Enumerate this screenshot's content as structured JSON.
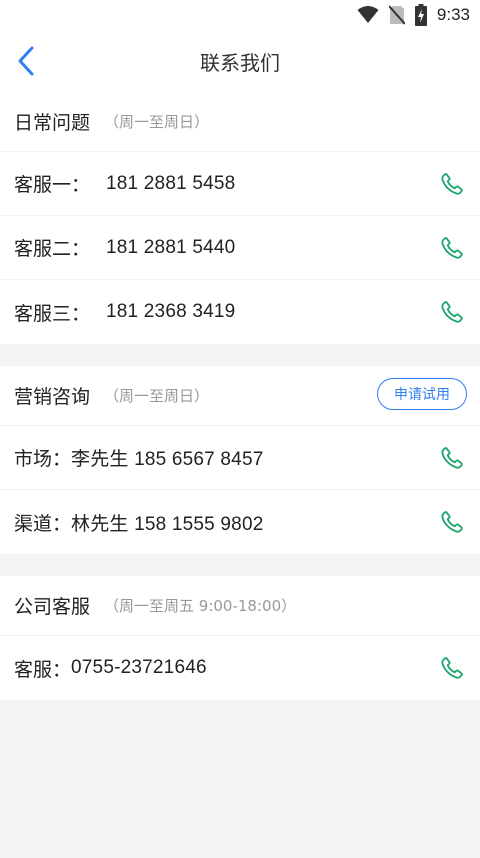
{
  "status_bar": {
    "time": "9:33"
  },
  "header": {
    "title": "联系我们"
  },
  "sections": [
    {
      "title": "日常问题",
      "note": "（周一至周日）",
      "rows": [
        {
          "label": "客服一：",
          "value": "181 2881 5458"
        },
        {
          "label": "客服二：",
          "value": "181 2881 5440"
        },
        {
          "label": "客服三：",
          "value": "181 2368 3419"
        }
      ]
    },
    {
      "title": "营销咨询",
      "note": "（周一至周日）",
      "button": "申请试用",
      "rows": [
        {
          "label": "市场：",
          "value": "李先生 185 6567 8457"
        },
        {
          "label": "渠道：",
          "value": "林先生 158 1555 9802"
        }
      ]
    },
    {
      "title": "公司客服",
      "note": "（周一至周五 9:00-18:00）",
      "rows": [
        {
          "label": "客服：",
          "value": "0755-23721646"
        }
      ]
    }
  ],
  "colors": {
    "accent": "#2f7ff0",
    "phone": "#1aa56a"
  }
}
